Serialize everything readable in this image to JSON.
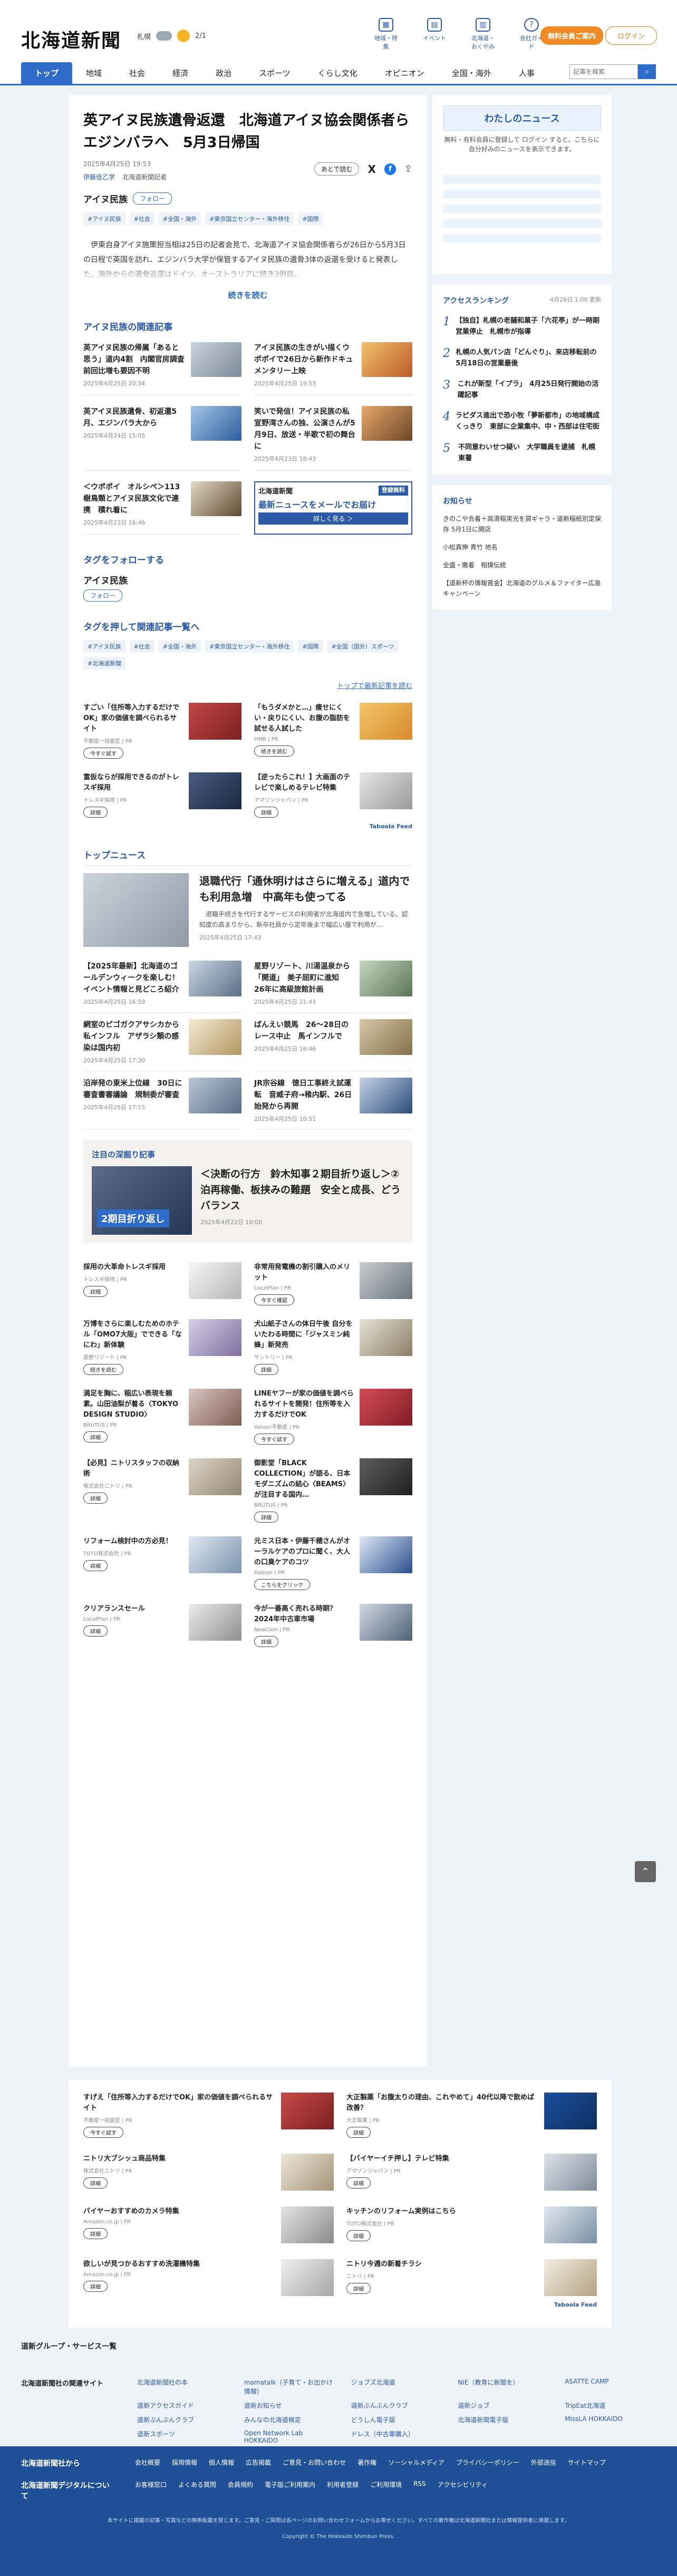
{
  "header": {
    "logo": "北海道新聞",
    "weather_city": "札幌",
    "weather_more": "2/1",
    "icons": [
      {
        "label": "地域・特集",
        "glyph": "▦"
      },
      {
        "label": "イベント",
        "glyph": "▤"
      },
      {
        "label": "北海道・おくやみ",
        "glyph": "▥"
      },
      {
        "label": "会社ガイド",
        "glyph": "?"
      }
    ],
    "subscribe": "無料会員ご案内",
    "login": "ログイン"
  },
  "nav": {
    "items": [
      "トップ",
      "地域",
      "社会",
      "経済",
      "政治",
      "スポーツ",
      "くらし文化",
      "オピニオン",
      "全国・海外",
      "人事"
    ],
    "search_placeholder": "記事を検索",
    "search_btn": "⌕"
  },
  "article": {
    "title": "英アイヌ民族遺骨返還　北海道アイヌ協会関係者らエジンバラへ　5月3日帰国",
    "date": "2025年4月25日 19:53",
    "byline_name": "伊藤佳乙学",
    "byline_org": "北海道新聞記者",
    "share_label": "あとで読む",
    "share_x": "X",
    "share_fb": "f",
    "share_up": "⇪",
    "tag_name": "アイヌ民族",
    "follow": "フォロー",
    "tags": [
      "#アイヌ民族",
      "#社会",
      "#全国・海外",
      "#東京国立センター・海外移住",
      "#国際"
    ],
    "lead": "　伊東自身アイヌ施策担当相は25日の記者会見で、北海道アイヌ協会関係者らが26日から5月3日の日程で英国を訪れ、エジンバラ大学が保管するアイヌ民族の遺骨3体の返還を受けると発表した。海外からの遺骨返還はドイツ、オーストラリアに続き3例目。",
    "readmore": "続きを読む"
  },
  "related": {
    "heading": "アイヌ民族の関連記事",
    "items": [
      {
        "title": "英アイヌ民族の帰属「あると思う」道内4割　内閣官房調査　前回比増も要因不明",
        "date": "2025年4月25日 20:34",
        "c1": "#c8d3dd",
        "c2": "#7d8a98"
      },
      {
        "title": "アイヌ民族の生きがい描くウポポイで26日から新作ドキュメンタリー上映",
        "date": "2025年4月25日 19:53",
        "c1": "#f1c26d",
        "c2": "#bd5a27"
      },
      {
        "title": "英アイヌ民族遺骨、初返還5月、エジンバラ大から",
        "date": "2025年4月24日 15:05",
        "c1": "#a5c4e6",
        "c2": "#2d5f9e"
      },
      {
        "title": "笑いで発信！アイヌ民族の私　宣野湾さんの独、公演さんが5月9日、放送・半歌で初の舞台に",
        "date": "2025年4月23日 18:43",
        "c1": "#e9a86a",
        "c2": "#6a4628"
      },
      {
        "title": "＜ウポポイ　オルシペ＞113　樹鳥類とアイヌ民族文化で連携　積れ着に",
        "date": "2025年4月23日 16:46",
        "c1": "#e3d9c6",
        "c2": "#5e4b32"
      }
    ],
    "mail_brand": "北海道新聞",
    "mail_badge": "登録無料",
    "mail_headline": "最新ニュースをメールでお届け",
    "mail_cta": "詳しく見る ＞"
  },
  "tagfollow": {
    "heading": "タグをフォローする",
    "tag_name": "アイヌ民族",
    "follow": "フォロー",
    "heading2": "タグを押して関連記事一覧へ",
    "tags": [
      "#アイヌ民族",
      "#社会",
      "#全国・海外",
      "#東京国立センター・海外移住",
      "#国際",
      "#全国（国外）スポーツ",
      "#北海道新聞"
    ],
    "back": "トップで最新記事を読む"
  },
  "ads1": {
    "items": [
      {
        "title": "すごい「住所等入力するだけでOK」家の価値を調べられるサイト",
        "sponsor": "不動産一括査定 | PR",
        "cta": "今すぐ試す",
        "c1": "#c44545",
        "c2": "#7c2222"
      },
      {
        "title": "「もうダメかと…」痩せにくい・戻りにくい、お腹の脂肪を試せる人試した",
        "sponsor": "HMB | PR",
        "cta": "続きを読む",
        "c1": "#f2c56b",
        "c2": "#d88a2c"
      },
      {
        "title": "富仮ならが採用できるのがトレスギ採用",
        "sponsor": "トレスギ採用 | PR",
        "cta": "詳細",
        "c1": "#495c80",
        "c2": "#1b2840"
      },
      {
        "title": "【逆ったらこれ！】大画面のテレビで楽しめるテレビ特集",
        "sponsor": "アマゾンジャパン | PR",
        "cta": "詳細",
        "c1": "#e6e6e6",
        "c2": "#9a9a9a"
      }
    ],
    "taboola": "Taboola Feed"
  },
  "topnews": {
    "heading": "トップニュース",
    "lead_title": "退職代行「通休明けはさらに増える」道内でも利用急増　中高年も使ってる",
    "lead_summary": "　退職手続きを代行するサービスの利用者が北海道内で急増している。認知度の高まりから、新卒社員から定年後まで幅広い層で利用が…",
    "lead_date": "2025年4月25日 17:43",
    "items": [
      {
        "title": "【2025年最新】北海道のゴールデンウィークを楽しむ！イベント情報と見どころ紹介",
        "date": "2025年4月25日 16:59",
        "c1": "#c9d6e4",
        "c2": "#5c6f87"
      },
      {
        "title": "星野リゾート、川湯温泉から「開道」　美子屈町に進知　26年に高級旅館計画",
        "date": "2025年4月25日 21:43",
        "c1": "#c6d7c1",
        "c2": "#5b7454"
      },
      {
        "title": "網室のピゴガクアサシカから私インフル　アザラシ類の感染は国内初",
        "date": "2025年4月25日 17:30",
        "c1": "#f4ead4",
        "c2": "#b29660"
      },
      {
        "title": "ばんえい競馬　26〜28日のレース中止　馬インフルで",
        "date": "2025年4月25日 16:46",
        "c1": "#d7c7a6",
        "c2": "#85714b"
      },
      {
        "title": "沿岸発の東米上位線　30日に　審査書審議論　規制委が審査",
        "date": "2025年4月25日 17:15",
        "c1": "#b9c7d8",
        "c2": "#5a6b83"
      },
      {
        "title": "JR宗谷線　徳日工事終え試運転　音威子府→稚内駅、26日始発から再開",
        "date": "2025年4月25日 10:51",
        "c1": "#c5d2e4",
        "c2": "#2a4c7b"
      }
    ],
    "feature_heading": "注目の深掘り記事",
    "feature_badge": "2期目折り返し",
    "feature_title": "＜決断の行方　鈴木知事２期目折り返し＞②　泊再稼働、板挟みの難題　安全と成長、どうバランス",
    "feature_date": "2025年4月22日 10:00"
  },
  "ads2": {
    "items": [
      {
        "title": "採用の大革命トレスギ採用",
        "sponsor": "トレスギ採用 | PR",
        "cta": "詳細",
        "c1": "#f6f6f6",
        "c2": "#b6b6b6"
      },
      {
        "title": "非常用発電機の割引購入のメリット",
        "sponsor": "LocalPlan | PR",
        "cta": "今すぐ確認",
        "c1": "#c7cdd2",
        "c2": "#6b747c"
      },
      {
        "title": "万博をさらに楽しむためのホテル「OMO7大阪」でできる「なにわ」新体験",
        "sponsor": "星野リゾート | PR",
        "cta": "続きを読む",
        "c1": "#d7d0e7",
        "c2": "#7e6e9e"
      },
      {
        "title": "犬山紙子さんの体日午後 自分をいたわる時間に「ジャスミン純蜂」新発売",
        "sponsor": "サントリー | PR",
        "cta": "詳細",
        "c1": "#e6e2d7",
        "c2": "#8b7f65"
      },
      {
        "title": "満足を胸に、稲広い表現を頼素。山田油梨が着る〈TOKYO DESIGN STUDIO〉",
        "sponsor": "BRUTUS | PR",
        "cta": "詳細",
        "c1": "#d8c5c0",
        "c2": "#7f5d54"
      },
      {
        "title": "LINEヤフーが家の価値を調べられるサイトを開発！住所等を入力するだけでOK",
        "sponsor": "Yahoo!不動産 | PR",
        "cta": "今すぐ試す",
        "c1": "#d44b55",
        "c2": "#811d27"
      },
      {
        "title": "【必見】ニトリスタッフの収納術",
        "sponsor": "株式会社ニトリ | PR",
        "cta": "詳細",
        "c1": "#ddd6ca",
        "c2": "#928670"
      },
      {
        "title": "御影堂「BLACK COLLECTION」が語る、日本モダニズムの結心〈BEAMS〉が注目する国内…",
        "sponsor": "BRUTUS | PR",
        "cta": "詳細",
        "c1": "#5e5e5e",
        "c2": "#1f1f1f"
      },
      {
        "title": "リフォーム検討中の方必見！",
        "sponsor": "TOTO株式会社 | PR",
        "cta": "詳細",
        "c1": "#dfe8f1",
        "c2": "#7c94ad"
      },
      {
        "title": "元ミス日本・伊藤千穂さんがオーラルケアのプロに聞く、大人の口臭ケアのコツ",
        "sponsor": "Haleon | PR",
        "cta": "こちらをクリック",
        "c1": "#dfe7f3",
        "c2": "#2a4f8f"
      },
      {
        "title": "クリアランスセール",
        "sponsor": "LocalPlan | PR",
        "cta": "詳細",
        "c1": "#ececec",
        "c2": "#8f8f8f"
      },
      {
        "title": "今が一番高く売れる時期？2024年中古車市場",
        "sponsor": "NewCom | PR",
        "cta": "詳細",
        "c1": "#d1d9e3",
        "c2": "#4f6178"
      }
    ]
  },
  "side": {
    "my_news": "わたしのニュース",
    "my_news_desc": "無料・有料会員に登録して ログイン すると、こちらに自分好みのニュースを表示できます。",
    "ranking_h": "アクセスランキング",
    "ranking_date": "4月26日 1:00 更新",
    "ranking": [
      {
        "n": "1",
        "t": "【独自】札幌の老舗和菓子「六花亭」が一時期営業停止　札幌市が指導"
      },
      {
        "n": "2",
        "t": "札幌の人気パン店「どんぐり」、来店移転前の5月18日の営業最後"
      },
      {
        "n": "3",
        "t": "これが新型「イプラ」　4月25日発行開始の活躍記事"
      },
      {
        "n": "4",
        "t": "ラピダス進出で恐小牧「夢新都市」の地域構成くっきり　東部に企業集中、中・西部は住宅街"
      },
      {
        "n": "5",
        "t": "不同意わいせつ疑い　大学職員を逮捕　札幌東署"
      }
    ],
    "osusume_h": "お知らせ",
    "osusume": [
      "きのこや合着＋高清稲実光を貸ギャラ・道新稲紙別定保存 5月1日に開店",
      "小松真伸 青竹 地名",
      "全盛・撒着　相撲伝統",
      "【道新杯の情報賞金】北海道のグルメ＆ファイター広島キャンペーン"
    ]
  },
  "bottom_ads": {
    "items": [
      {
        "title": "すげえ「住所等入力するだけでOK」家の価値を調べられるサイト",
        "sponsor": "不動産一括査定 | PR",
        "cta": "今すぐ試す",
        "c1": "#c94a4a",
        "c2": "#7a2020"
      },
      {
        "title": "大正製薬「お腹太りの理由、これやめて」40代以降で飲めば改善？",
        "sponsor": "大正製薬 | PR",
        "cta": "詳細",
        "c1": "#1b4f9e",
        "c2": "#0f2f60"
      },
      {
        "title": "ニトリ大ブシッュ商品特集",
        "sponsor": "株式会社ニトリ | PR",
        "cta": "詳細",
        "c1": "#ece6da",
        "c2": "#a49579"
      },
      {
        "title": "【バイヤーイチ押し】テレビ特集",
        "sponsor": "アマゾンジャパン | PR",
        "cta": "詳細",
        "c1": "#dde3e8",
        "c2": "#7e8c98"
      },
      {
        "title": "バイヤーおすすめのカメラ特集",
        "sponsor": "Amazon.co.jp | PR",
        "cta": "詳細",
        "c1": "#e5e5e5",
        "c2": "#8a8a8a"
      },
      {
        "title": "キッチンのリフォーム実例はこちら",
        "sponsor": "TOTO株式会社 | PR",
        "cta": "詳細",
        "c1": "#e0e8ef",
        "c2": "#7a8fa3"
      },
      {
        "title": "欲しいが見つかるおすすめ洗濯機特集",
        "sponsor": "Amazon.co.jp | PR",
        "cta": "詳細",
        "c1": "#f0f0f0",
        "c2": "#a6a6a6"
      },
      {
        "title": "ニトリ今週の新着チラシ",
        "sponsor": "ニトリ | PR",
        "cta": "詳細",
        "c1": "#f3eee3",
        "c2": "#b3a282"
      }
    ],
    "taboola": "Taboola Feed"
  },
  "footer": {
    "groups": "道新グループ・サービス一覧",
    "related_h": "北海道新聞社の関連サイト",
    "related": [
      "北海道新聞社の本",
      "mamatalk（子育て・お出かけ情報）",
      "ジョブズ北海道",
      "NIE（教育に新聞を）",
      "ASATTE CAMP",
      "道新アクセスガイド",
      "道新お知らせ",
      "道新ぶんぶんクラブ",
      "道新ジョブ",
      "TripEat北海道",
      "道新ぶんぶんクラブ",
      "みんなの北海道検定",
      "どうしん電子版",
      "北海道新聞電子版",
      "MissLA HOKKAIDO",
      "道新スポーツ",
      "Open Network Lab HOKKAIDO",
      "ドレス（中古車購入）"
    ],
    "company_h": "北海道新聞社から",
    "company_links": [
      "会社概要",
      "採用情報",
      "個人情報",
      "広告掲載",
      "ご意見・お問い合わせ",
      "著作権",
      "ソーシャルメディア",
      "プライバシーポリシー",
      "外部送信",
      "サイトマップ"
    ],
    "digital_h": "北海道新聞デジタルについて",
    "digital_links": [
      "お客様窓口",
      "よくある質問",
      "会員規約",
      "電子版ご利用案内",
      "利用者登録",
      "ご利用環境",
      "RSS",
      "アクセシビリティ"
    ],
    "note": "本サイトに掲載の記事・写真などの無断転載を禁じます。ご意見・ご質問は各ページのお問い合わせフォームからお寄せください。すべての著作権は北海道新聞社または情報提供者に帰属します。",
    "copyright": "Copyright © The Hokkaido Shimbun Press."
  }
}
